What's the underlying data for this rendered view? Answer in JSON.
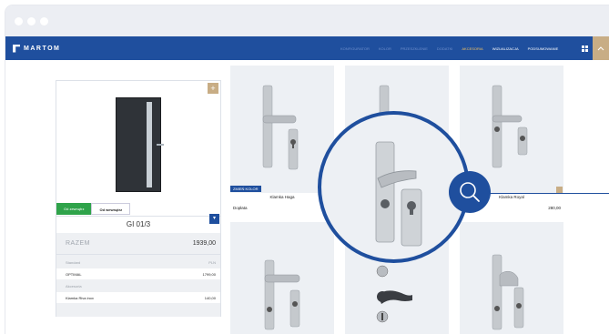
{
  "brand": {
    "name": "MARTOM"
  },
  "nav": {
    "steps": [
      {
        "label": "konfigurator",
        "state": "inactive"
      },
      {
        "label": "kolor",
        "state": "inactive"
      },
      {
        "label": "przeszklenie",
        "state": "inactive"
      },
      {
        "label": "dodatki",
        "state": "inactive"
      },
      {
        "label": "akcesoria",
        "state": "active"
      },
      {
        "label": "wizualizacja",
        "state": "done"
      },
      {
        "label": "podsumowanie",
        "state": "done"
      }
    ],
    "menu_icon": "grid-icon",
    "collapse_icon": "chevron-up-icon"
  },
  "configurator": {
    "view_tabs": [
      "Od zewnątrz",
      "Od wewnątrz"
    ],
    "model_name": "GI 01/3",
    "total_label": "RAZEM",
    "total_value": "1939,00",
    "lines": [
      {
        "label": "Standard",
        "value": "PLN",
        "style": "muted"
      },
      {
        "label": "OPTIMAL",
        "value": "1799,00",
        "style": "strong"
      },
      {
        "label": "Akcesoria",
        "value": "",
        "style": "muted"
      },
      {
        "label": "Klamka Riva inox",
        "value": "140,00",
        "style": "strong"
      }
    ]
  },
  "products": {
    "card1": {
      "badge": "ZMIEŃ KOLOR",
      "name": "Klamka Haga",
      "sub": "Dopłata"
    },
    "card3": {
      "name": "Klamka Royal",
      "price": "280,00"
    }
  },
  "colors": {
    "primary": "#1f4f9e",
    "accent": "#c8ad85",
    "green": "#2fa34a",
    "card_bg": "#edf0f4"
  }
}
